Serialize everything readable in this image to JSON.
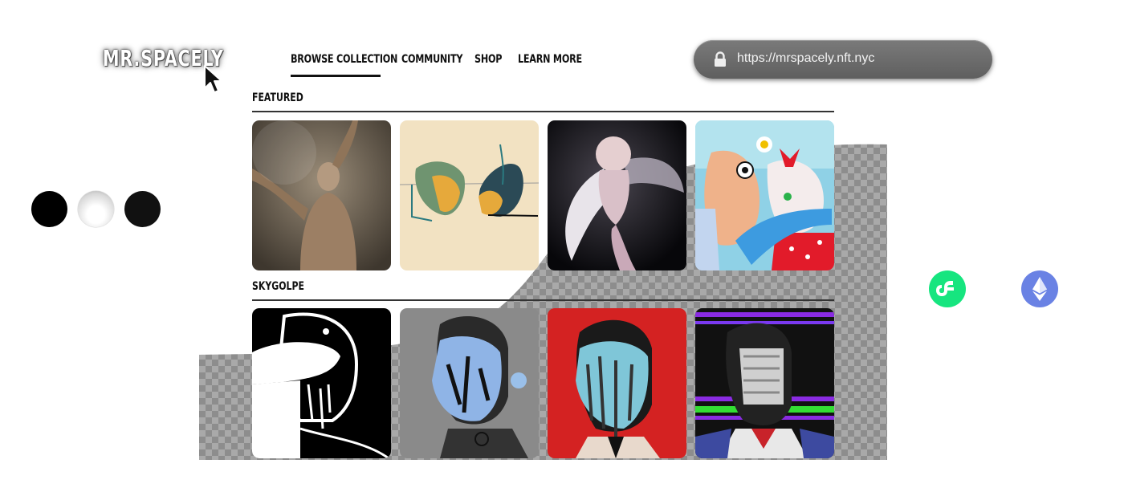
{
  "brand": {
    "logo_text": "MR.SPACELY"
  },
  "nav": {
    "items": [
      {
        "label": "BROWSE COLLECTION",
        "active": true
      },
      {
        "label": "COMMUNITY",
        "active": false
      },
      {
        "label": "SHOP",
        "active": false
      },
      {
        "label": "LEARN MORE",
        "active": false
      }
    ]
  },
  "browser": {
    "url": "https://mrspacely.nft.nyc",
    "icon": "lock-icon"
  },
  "sections": [
    {
      "title": "FEATURED"
    },
    {
      "title": "SKYGOLPE"
    }
  ],
  "dots": [
    {
      "name": "black-dot",
      "color": "#000000"
    },
    {
      "name": "white-dot",
      "color": "#f4f4f4"
    },
    {
      "name": "dark-dot",
      "color": "#111111"
    }
  ],
  "chains": [
    {
      "icon": "flow-icon",
      "color": "#16e57f"
    },
    {
      "icon": "ethereum-icon",
      "color": "#6a82e4"
    }
  ],
  "colors": {
    "accent": "#111111",
    "urlbar": "#6b6b6b"
  }
}
